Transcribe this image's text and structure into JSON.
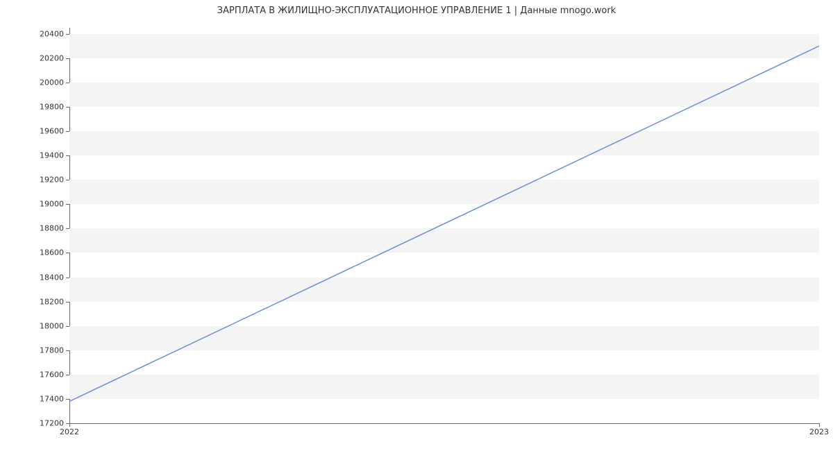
{
  "chart_data": {
    "type": "line",
    "title": "ЗАРПЛАТА В  ЖИЛИЩНО-ЭКСПЛУАТАЦИОННОЕ УПРАВЛЕНИЕ 1 | Данные mnogo.work",
    "x": [
      2022,
      2023
    ],
    "y": [
      17380,
      20300
    ],
    "x_ticks": [
      2022,
      2023
    ],
    "y_ticks": [
      17200,
      17400,
      17600,
      17800,
      18000,
      18200,
      18400,
      18600,
      18800,
      19000,
      19200,
      19400,
      19600,
      19800,
      20000,
      20200,
      20400
    ],
    "ylim": [
      17200,
      20450
    ],
    "xlim": [
      2022,
      2023
    ],
    "xlabel": "",
    "ylabel": "",
    "line_color": "#6a8fd8",
    "grid_band_color": "#f4f4f4"
  }
}
